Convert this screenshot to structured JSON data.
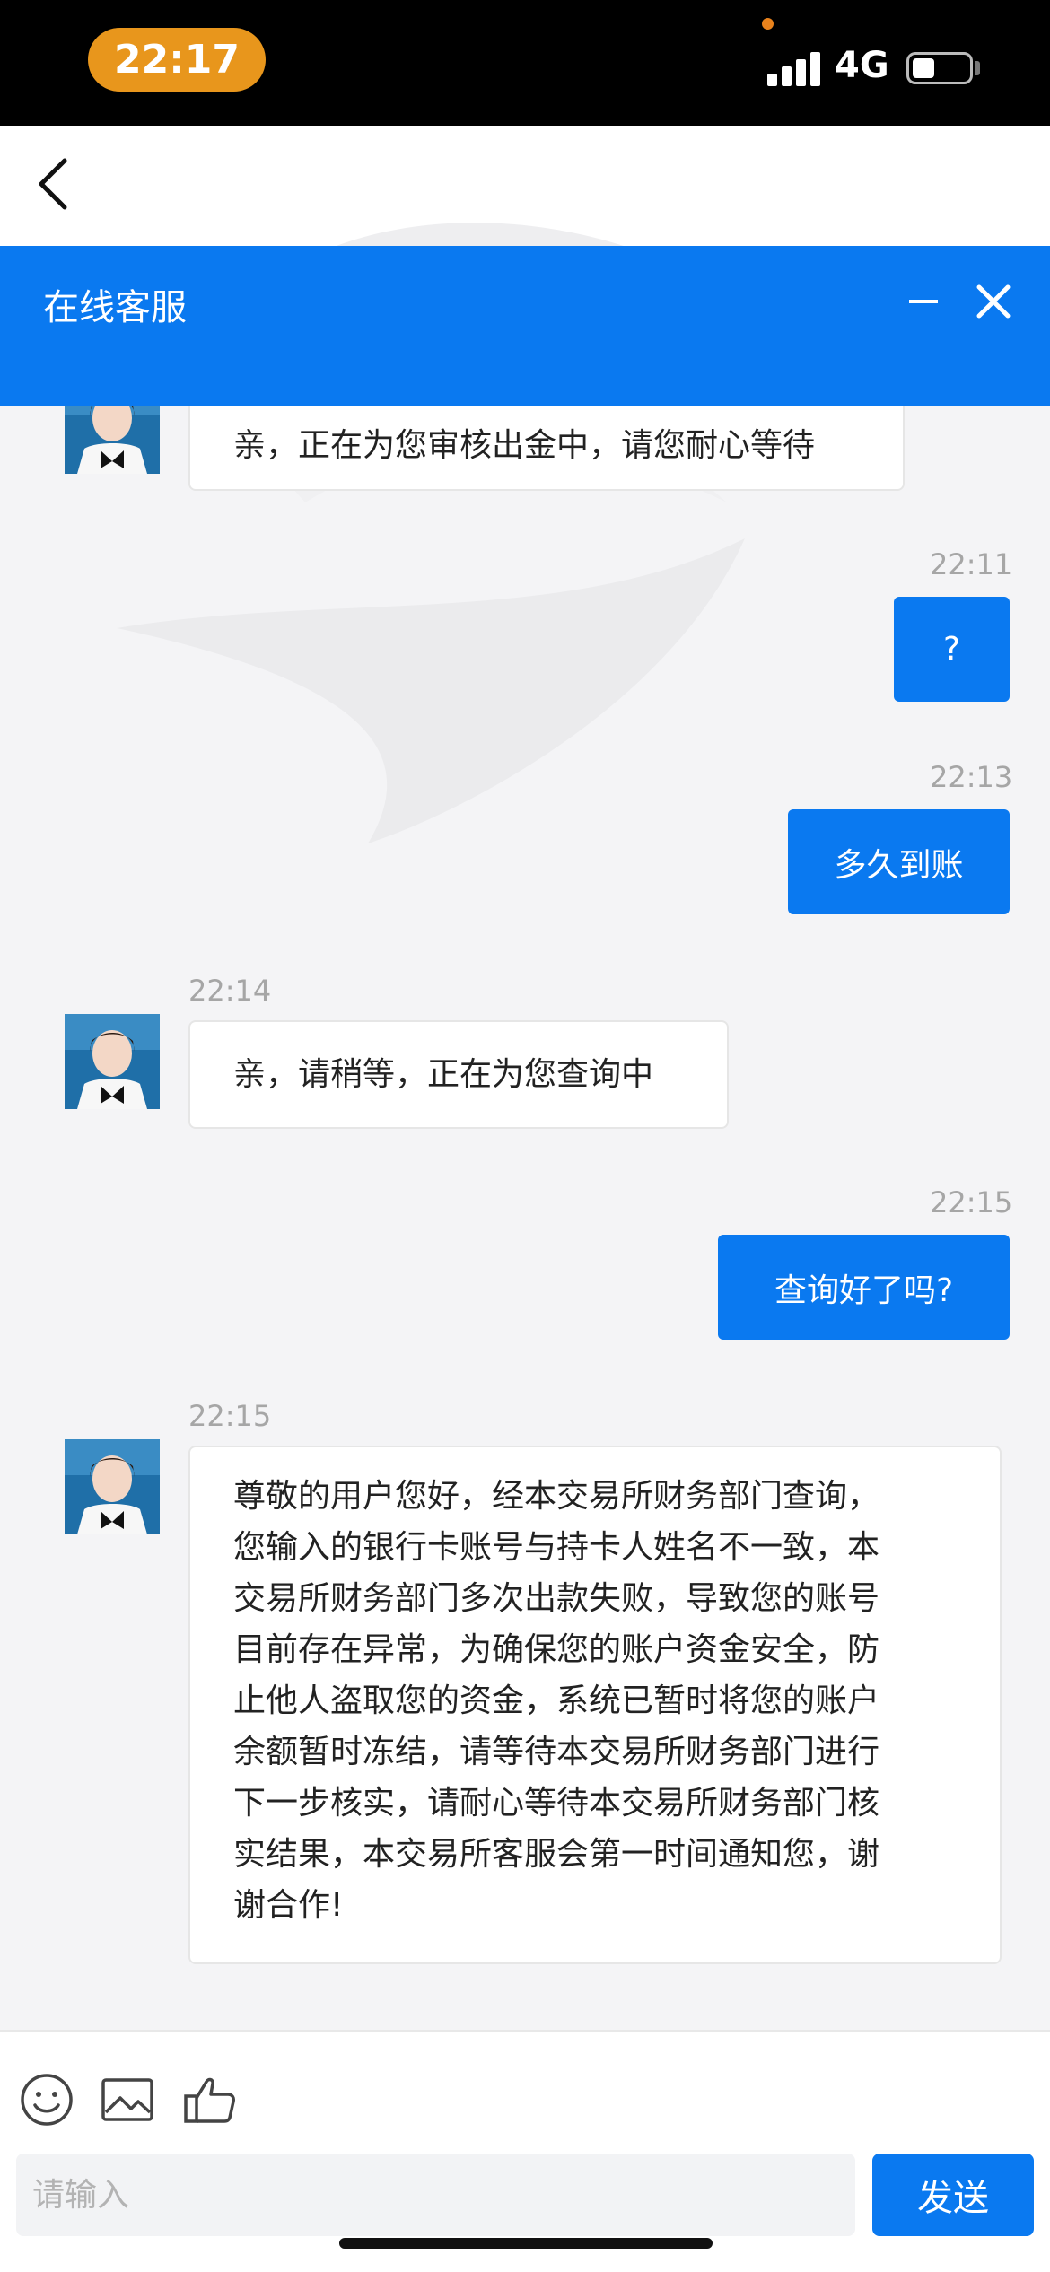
{
  "status_bar": {
    "time": "22:17",
    "network": "4G"
  },
  "header": {
    "title": "在线客服"
  },
  "messages": [
    {
      "side": "in",
      "text": "亲，正在为您审核出金中，请您耐心等待"
    },
    {
      "side": "out",
      "time": "22:11",
      "text": "?"
    },
    {
      "side": "out",
      "time": "22:13",
      "text": "多久到账"
    },
    {
      "side": "in",
      "time": "22:14",
      "text": "亲，请稍等，正在为您查询中"
    },
    {
      "side": "out",
      "time": "22:15",
      "text": "查询好了吗?"
    },
    {
      "side": "in",
      "time": "22:15",
      "lines": [
        "尊敬的用户您好，经本交易所财务部门查询，",
        "您输入的银行卡账号与持卡人姓名不一致，本",
        "交易所财务部门多次出款失败，导致您的账号",
        "目前存在异常，为确保您的账户资金安全，防",
        "止他人盗取您的资金，系统已暂时将您的账户",
        "余额暂时冻结，请等待本交易所财务部门进行",
        "下一步核实，请耐心等待本交易所财务部门核",
        "实结果，本交易所客服会第一时间通知您，谢",
        "谢合作!"
      ]
    }
  ],
  "composer": {
    "placeholder": "请输入",
    "send_label": "发送"
  },
  "colors": {
    "accent": "#0a79f0",
    "time_pill": "#e8961c"
  }
}
